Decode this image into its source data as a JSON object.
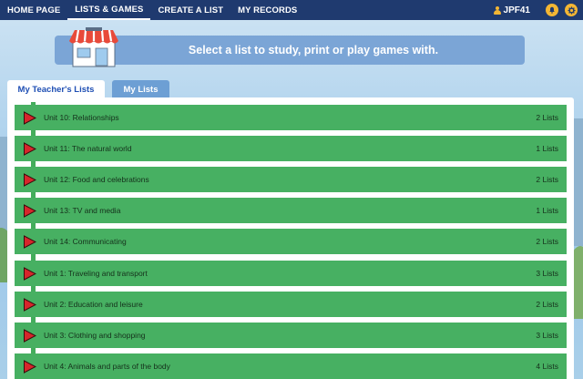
{
  "nav": {
    "items": [
      {
        "label": "HOME PAGE"
      },
      {
        "label": "LISTS & GAMES"
      },
      {
        "label": "CREATE A LIST"
      },
      {
        "label": "MY RECORDS"
      }
    ],
    "active_index": 1,
    "username": "JPF41",
    "icons": [
      "user-icon",
      "bell-icon",
      "gear-icon"
    ]
  },
  "banner": {
    "text": "Select a list to study, print or play games with."
  },
  "tabs": [
    {
      "label": "My Teacher's Lists",
      "active": true
    },
    {
      "label": "My Lists",
      "active": false
    }
  ],
  "units": [
    {
      "title": "Unit 10: Relationships",
      "count": "2 Lists"
    },
    {
      "title": "Unit 11: The natural world",
      "count": "1 Lists"
    },
    {
      "title": "Unit 12: Food and celebrations",
      "count": "2 Lists"
    },
    {
      "title": "Unit 13: TV and media",
      "count": "1 Lists"
    },
    {
      "title": "Unit 14: Communicating",
      "count": "2 Lists"
    },
    {
      "title": "Unit 1: Traveling and transport",
      "count": "3 Lists"
    },
    {
      "title": "Unit 2: Education and leisure",
      "count": "2 Lists"
    },
    {
      "title": "Unit 3: Clothing and shopping",
      "count": "3 Lists"
    },
    {
      "title": "Unit 4: Animals and parts of the body",
      "count": "4 Lists"
    }
  ],
  "colors": {
    "nav_bg": "#1f3a6f",
    "row_green": "#47b062",
    "banner_blue": "#7ba5d6",
    "tab_active_text": "#1f4fb4",
    "accent_yellow": "#f3b634",
    "play_red": "#d6262b"
  }
}
